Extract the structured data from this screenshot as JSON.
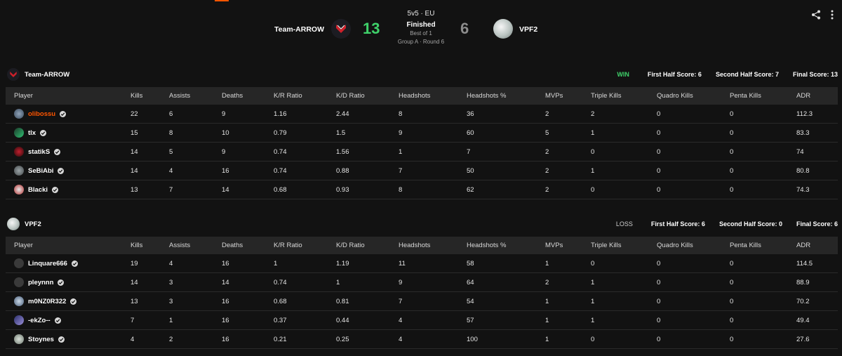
{
  "match": {
    "format": "5v5 · EU",
    "status": "Finished",
    "best_of": "Best of 1",
    "stage": "Group A · Round 6",
    "left_team": "Team-ARROW",
    "left_score": "13",
    "right_team": "VPF2",
    "right_score": "6",
    "left_score_color": "#3fd16a",
    "right_score_color": "#8c8c8c"
  },
  "actions": {
    "share_icon": "share-icon",
    "more_icon": "more-vertical-icon"
  },
  "columns": [
    "Player",
    "Kills",
    "Assists",
    "Deaths",
    "K/R Ratio",
    "K/D Ratio",
    "Headshots",
    "Headshots %",
    "MVPs",
    "Triple Kills",
    "Quadro Kills",
    "Penta Kills",
    "ADR"
  ],
  "teams": [
    {
      "name": "Team-ARROW",
      "result": "WIN",
      "first_half": "First Half Score: 6",
      "second_half": "Second Half Score: 7",
      "final": "Final Score: 13",
      "players": [
        {
          "name": "olibossu",
          "highlight": true,
          "stats": [
            "22",
            "6",
            "9",
            "1.16",
            "2.44",
            "8",
            "36",
            "2",
            "2",
            "0",
            "0",
            "112.3"
          ]
        },
        {
          "name": "tlx",
          "stats": [
            "15",
            "8",
            "10",
            "0.79",
            "1.5",
            "9",
            "60",
            "5",
            "1",
            "0",
            "0",
            "83.3"
          ]
        },
        {
          "name": "statikS",
          "stats": [
            "14",
            "5",
            "9",
            "0.74",
            "1.56",
            "1",
            "7",
            "2",
            "0",
            "0",
            "0",
            "74"
          ]
        },
        {
          "name": "SeBiAbi",
          "stats": [
            "14",
            "4",
            "16",
            "0.74",
            "0.88",
            "7",
            "50",
            "2",
            "1",
            "0",
            "0",
            "80.8"
          ]
        },
        {
          "name": "Blacki",
          "stats": [
            "13",
            "7",
            "14",
            "0.68",
            "0.93",
            "8",
            "62",
            "2",
            "0",
            "0",
            "0",
            "74.3"
          ]
        }
      ]
    },
    {
      "name": "VPF2",
      "result": "LOSS",
      "first_half": "First Half Score: 6",
      "second_half": "Second Half Score: 0",
      "final": "Final Score: 6",
      "players": [
        {
          "name": "Linquare666",
          "stats": [
            "19",
            "4",
            "16",
            "1",
            "1.19",
            "11",
            "58",
            "1",
            "0",
            "0",
            "0",
            "114.5"
          ]
        },
        {
          "name": "pleynnn",
          "stats": [
            "14",
            "3",
            "14",
            "0.74",
            "1",
            "9",
            "64",
            "2",
            "1",
            "0",
            "0",
            "88.9"
          ]
        },
        {
          "name": "m0NZ0R322",
          "stats": [
            "13",
            "3",
            "16",
            "0.68",
            "0.81",
            "7",
            "54",
            "1",
            "1",
            "0",
            "0",
            "70.2"
          ]
        },
        {
          "name": "-ekZo--",
          "stats": [
            "7",
            "1",
            "16",
            "0.37",
            "0.44",
            "4",
            "57",
            "1",
            "1",
            "0",
            "0",
            "49.4"
          ]
        },
        {
          "name": "Stoynes",
          "stats": [
            "4",
            "2",
            "16",
            "0.21",
            "0.25",
            "4",
            "100",
            "1",
            "0",
            "0",
            "0",
            "27.6"
          ]
        }
      ]
    }
  ]
}
